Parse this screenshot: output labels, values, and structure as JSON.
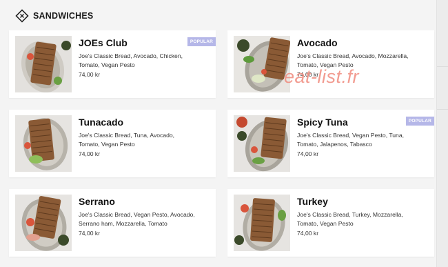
{
  "section": {
    "title": "SANDWICHES"
  },
  "watermark": "eat-list.fr",
  "colors": {
    "badge": "#b5b7e8",
    "watermark": "#f08b7e"
  },
  "items": [
    {
      "name": "JOEs Club",
      "description": "Joe's Classic Bread, Avocado, Chicken, Tomato, Vegan Pesto",
      "price": "74,00 kr",
      "badge": "POPULAR"
    },
    {
      "name": "Avocado",
      "description": "Joe's Classic Bread, Avocado, Mozzarella, Tomato, Vegan Pesto",
      "price": "74,00 kr",
      "badge": ""
    },
    {
      "name": "Tunacado",
      "description": "Joe's Classic Bread, Tuna, Avocado, Tomato, Vegan Pesto",
      "price": "74,00 kr",
      "badge": ""
    },
    {
      "name": "Spicy Tuna",
      "description": "Joe's Classic Bread, Vegan Pesto, Tuna, Tomato, Jalapenos, Tabasco",
      "price": "74,00 kr",
      "badge": "POPULAR"
    },
    {
      "name": "Serrano",
      "description": "Joe's Classic Bread, Vegan Pesto, Avocado, Serrano ham, Mozzarella, Tomato",
      "price": "74,00 kr",
      "badge": ""
    },
    {
      "name": "Turkey",
      "description": "Joe's Classic Bread, Turkey, Mozzarella, Tomato, Vegan Pesto",
      "price": "74,00 kr",
      "badge": ""
    }
  ]
}
